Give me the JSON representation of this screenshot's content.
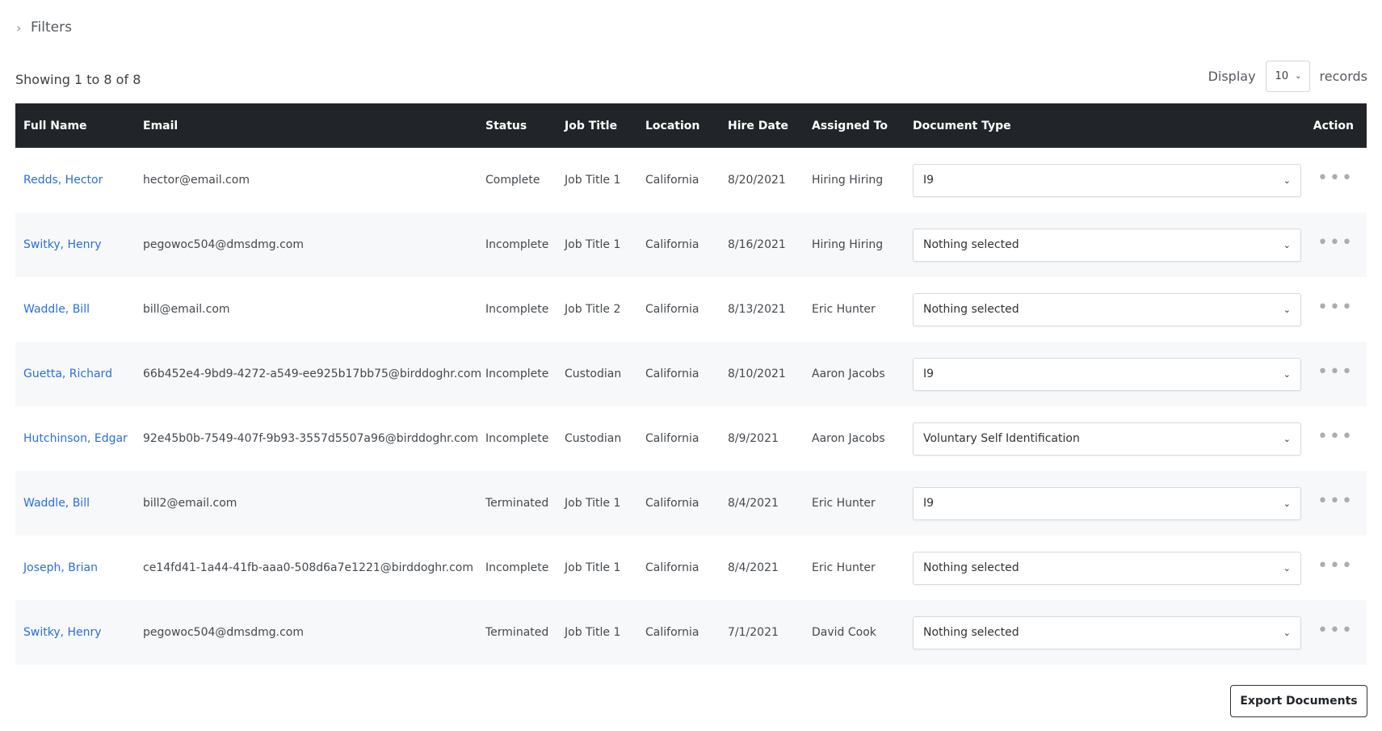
{
  "filters": {
    "label": "Filters",
    "icon": "chevron-right-icon"
  },
  "summary": {
    "showing": "Showing 1 to 8 of 8"
  },
  "display": {
    "label": "Display",
    "value": "10",
    "suffix": "records"
  },
  "table": {
    "headers": {
      "full_name": "Full Name",
      "email": "Email",
      "status": "Status",
      "job_title": "Job Title",
      "location": "Location",
      "hire_date": "Hire Date",
      "assigned_to": "Assigned To",
      "document_type": "Document Type",
      "action": "Action"
    },
    "rows": [
      {
        "full_name": "Redds, Hector",
        "email": "hector@email.com",
        "status": "Complete",
        "job_title": "Job Title 1",
        "location": "California",
        "hire_date": "8/20/2021",
        "assigned_to": "Hiring Hiring",
        "document_type": "I9"
      },
      {
        "full_name": "Switky, Henry",
        "email": "pegowoc504@dmsdmg.com",
        "status": "Incomplete",
        "job_title": "Job Title 1",
        "location": "California",
        "hire_date": "8/16/2021",
        "assigned_to": "Hiring Hiring",
        "document_type": "Nothing selected"
      },
      {
        "full_name": "Waddle, Bill",
        "email": "bill@email.com",
        "status": "Incomplete",
        "job_title": "Job Title 2",
        "location": "California",
        "hire_date": "8/13/2021",
        "assigned_to": "Eric Hunter",
        "document_type": "Nothing selected"
      },
      {
        "full_name": "Guetta, Richard",
        "email": "66b452e4-9bd9-4272-a549-ee925b17bb75@birddoghr.com",
        "status": "Incomplete",
        "job_title": "Custodian",
        "location": "California",
        "hire_date": "8/10/2021",
        "assigned_to": "Aaron Jacobs",
        "document_type": "I9"
      },
      {
        "full_name": "Hutchinson, Edgar",
        "email": "92e45b0b-7549-407f-9b93-3557d5507a96@birddoghr.com",
        "status": "Incomplete",
        "job_title": "Custodian",
        "location": "California",
        "hire_date": "8/9/2021",
        "assigned_to": "Aaron Jacobs",
        "document_type": "Voluntary Self Identification"
      },
      {
        "full_name": "Waddle, Bill",
        "email": "bill2@email.com",
        "status": "Terminated",
        "job_title": "Job Title 1",
        "location": "California",
        "hire_date": "8/4/2021",
        "assigned_to": "Eric Hunter",
        "document_type": "I9"
      },
      {
        "full_name": "Joseph, Brian",
        "email": "ce14fd41-1a44-41fb-aaa0-508d6a7e1221@birddoghr.com",
        "status": "Incomplete",
        "job_title": "Job Title 1",
        "location": "California",
        "hire_date": "8/4/2021",
        "assigned_to": "Eric Hunter",
        "document_type": "Nothing selected"
      },
      {
        "full_name": "Switky, Henry",
        "email": "pegowoc504@dmsdmg.com",
        "status": "Terminated",
        "job_title": "Job Title 1",
        "location": "California",
        "hire_date": "7/1/2021",
        "assigned_to": "David Cook",
        "document_type": "Nothing selected"
      }
    ]
  },
  "export": {
    "label": "Export Documents"
  },
  "colors": {
    "header_bg": "#212529",
    "link": "#2a6fdb",
    "row_alt": "#f7f8fa"
  }
}
